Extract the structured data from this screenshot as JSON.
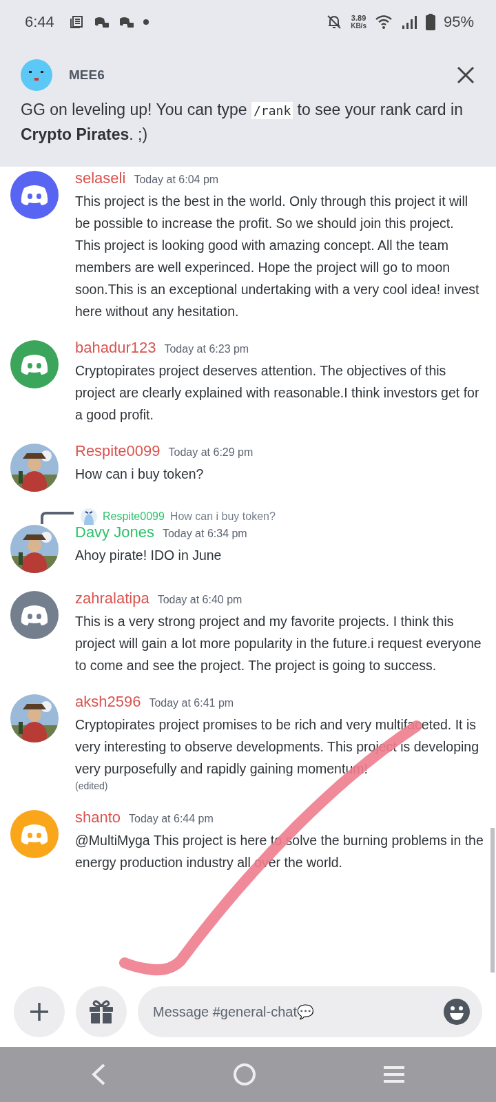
{
  "status_bar": {
    "time": "6:44",
    "speed": "3.89",
    "speed_unit": "KB/s",
    "battery": "95%"
  },
  "notification": {
    "sender": "MEE6",
    "text": "GG on leveling up! You can type ",
    "code": "/rank",
    "text_after": " to see your rank card in **Crypto Pirates**. ;)"
  },
  "messages": [
    {
      "author": "selaseli",
      "color": "#d9534f",
      "time": "Today at 6:04 pm",
      "avatar": {
        "kind": "discord",
        "color": "#5865f2"
      },
      "paragraphs": [
        "This project is the best in the world. Only through this project it will be possible to increase the profit. So we should join this project.",
        "This project is looking good with amazing concept. All the team members are well experinced. Hope the project will go to moon soon.This is an exceptional undertaking with a very cool idea! invest here without any hesitation."
      ]
    },
    {
      "author": "bahadur123",
      "color": "#d9534f",
      "time": "Today at 6:23 pm",
      "avatar": {
        "kind": "discord",
        "color": "#3ba55c"
      },
      "paragraphs": [
        "Cryptopirates project deserves attention. The objectives of this project are clearly explained with reasonable.I think investors get for a good profit."
      ]
    },
    {
      "author": "Respite0099",
      "color": "#d9534f",
      "time": "Today at 6:29 pm",
      "avatar": {
        "kind": "picture"
      },
      "paragraphs": [
        "How can i buy token?"
      ]
    },
    {
      "author": "Davy Jones",
      "color": "#2dc26b",
      "time": "Today at 6:34 pm",
      "avatar": {
        "kind": "picture"
      },
      "reply": {
        "author": "Respite0099",
        "text": "How can i buy token?"
      },
      "paragraphs": [
        "Ahoy pirate! IDO in June"
      ]
    },
    {
      "author": "zahralatipa",
      "color": "#d9534f",
      "time": "Today at 6:40 pm",
      "avatar": {
        "kind": "discord",
        "color": "#747f8d"
      },
      "paragraphs": [
        "This is a very strong project and my favorite projects. I think this project will gain a lot more popularity in the future.i request everyone to come and see the project. The project is going to success."
      ]
    },
    {
      "author": "aksh2596",
      "color": "#d9534f",
      "time": "Today at 6:41 pm",
      "avatar": {
        "kind": "picture"
      },
      "paragraphs": [
        "Cryptopirates project promises to be rich and very multifaceted. It is very interesting to observe developments. This project is developing very purposefully and rapidly gaining momentum!"
      ],
      "edited": "(edited)"
    },
    {
      "author": "shanto",
      "color": "#d9534f",
      "time": "Today at 6:44 pm",
      "avatar": {
        "kind": "discord",
        "color": "#faa61a"
      },
      "paragraphs": [
        "@MultiMyga This project is here to solve the burning problems in the energy production industry all over the world."
      ]
    }
  ],
  "composer": {
    "placeholder": "Message #general-chat💬"
  }
}
